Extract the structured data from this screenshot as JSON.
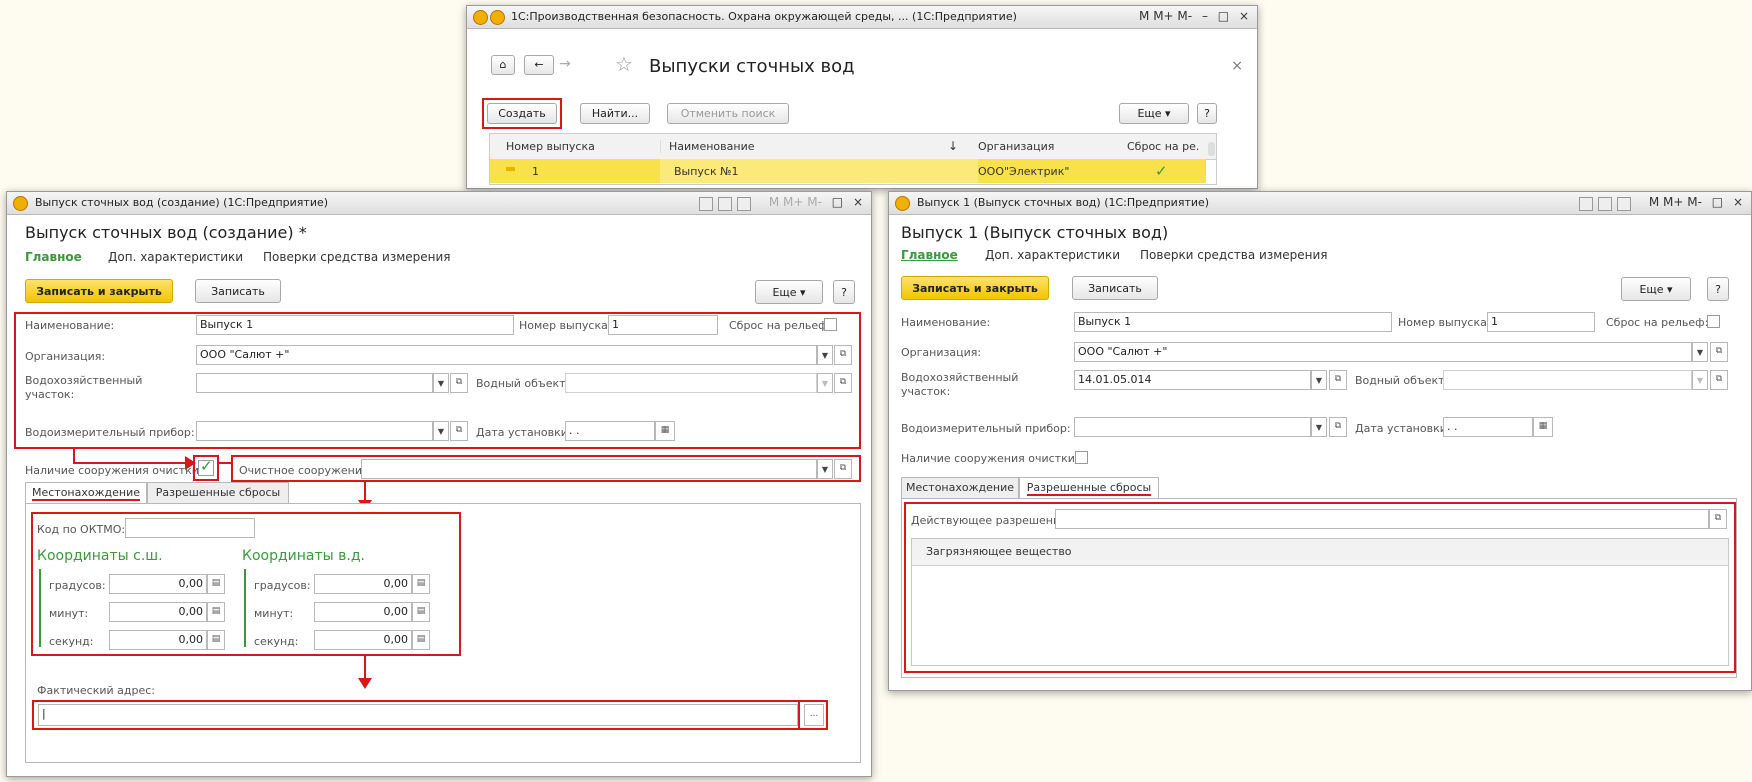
{
  "list_window": {
    "title": "1С:Производственная безопасность. Охрана окружающей среды, ... (1С:Предприятие)",
    "controls": "M  M+  M-",
    "form_title": "Выпуски сточных вод",
    "close_glyph": "×",
    "create_label": "Создать",
    "find_label": "Найти...",
    "cancel_search_label": "Отменить поиск",
    "more_label": "Еще",
    "help_label": "?",
    "columns": [
      "Номер выпуска",
      "Наименование",
      "Организация",
      "Сброс на ре."
    ],
    "sort_arrow": "↓",
    "rows": [
      {
        "number": "1",
        "name": "Выпуск №1",
        "org": "ООО\"Электрик\"",
        "check": "✓"
      }
    ]
  },
  "create_window": {
    "title": "Выпуск сточных вод (создание) (1С:Предприятие)",
    "form_title": "Выпуск сточных вод (создание) *",
    "nav": [
      "Главное",
      "Доп. характеристики",
      "Поверки средства измерения"
    ],
    "save_close_label": "Записать и закрыть",
    "save_label": "Записать",
    "more_label": "Еще",
    "help_label": "?",
    "fields": {
      "name_label": "Наименование:",
      "name_value": "Выпуск 1",
      "number_label": "Номер выпуска:",
      "number_value": "1",
      "relief_label": "Сброс на рельеф:",
      "org_label": "Организация:",
      "org_value": "ООО \"Салют +\"",
      "water_area_label": "Водохозяйственный участок:",
      "water_area_value": "",
      "water_object_label": "Водный объект:",
      "meter_label": "Водоизмерительный прибор:",
      "install_date_label": "Дата установки:",
      "install_date_value": " .  .",
      "treatment_present_label": "Наличие сооружения очистки:",
      "treatment_label": "Очистное сооружение:"
    },
    "tabs": [
      "Местонахождение",
      "Разрешенные сбросы"
    ],
    "oktmo_label": "Код по ОКТМО:",
    "coords_n_title": "Координаты с.ш.",
    "coords_e_title": "Координаты в.д.",
    "deg_label": "градусов:",
    "min_label": "минут:",
    "sec_label": "секунд:",
    "zero_value": "0,00",
    "address_label": "Фактический адрес:",
    "address_button": "..."
  },
  "view_window": {
    "title": "Выпуск 1 (Выпуск сточных вод) (1С:Предприятие)",
    "form_title": "Выпуск 1 (Выпуск сточных вод)",
    "nav": [
      "Главное",
      "Доп. характеристики",
      "Поверки средства измерения"
    ],
    "save_close_label": "Записать и закрыть",
    "save_label": "Записать",
    "more_label": "Еще",
    "help_label": "?",
    "fields": {
      "name_label": "Наименование:",
      "name_value": "Выпуск 1",
      "number_label": "Номер выпуска:",
      "number_value": "1",
      "relief_label": "Сброс на рельеф:",
      "org_label": "Организация:",
      "org_value": "ООО \"Салют +\"",
      "water_area_label": "Водохозяйственный участок:",
      "water_area_value": "14.01.05.014",
      "water_object_label": "Водный объект:",
      "meter_label": "Водоизмерительный прибор:",
      "install_date_label": "Дата установки:",
      "install_date_value": " .  .",
      "treatment_present_label": "Наличие сооружения очистки:"
    },
    "tabs": [
      "Местонахождение",
      "Разрешенные сбросы"
    ],
    "permit_label": "Действующее разрешение:",
    "pollutant_column": "Загрязняющее вещество"
  }
}
